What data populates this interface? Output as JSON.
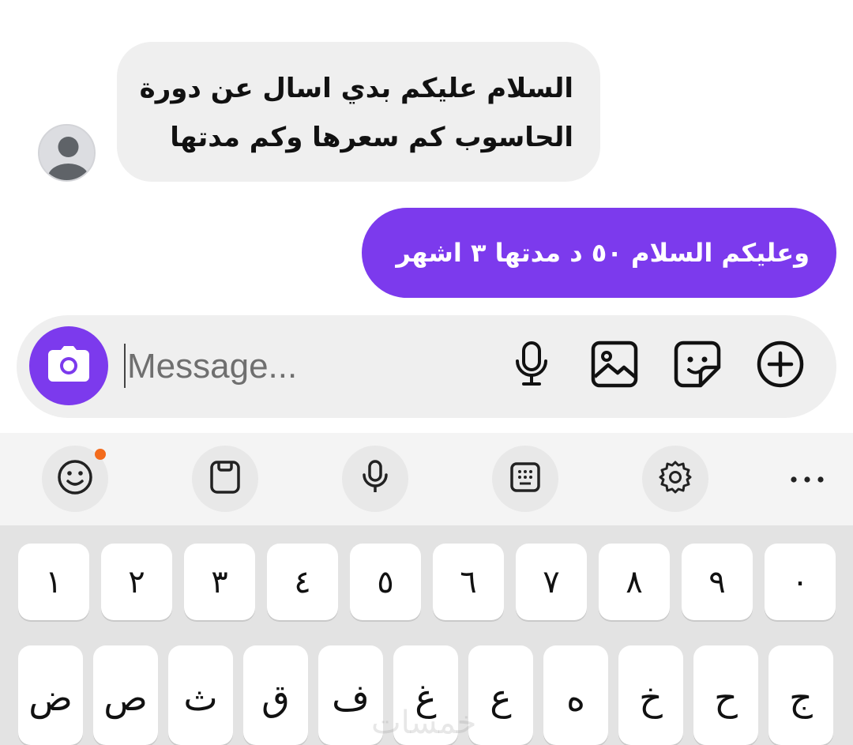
{
  "conversation": {
    "incoming": {
      "lines": [
        "السلام عليكم بدي اسال عن دورة",
        "الحاسوب كم سعرها وكم مدتها"
      ],
      "avatar_icon": "user-avatar-icon"
    },
    "outgoing": {
      "text": "وعليكم السلام ٥٠ د مدتها ٣ اشهر"
    },
    "colors": {
      "accent": "#7c3aed",
      "incoming_bubble": "#efefef"
    }
  },
  "composer": {
    "placeholder": "Message...",
    "value": "",
    "camera_icon": "camera-icon",
    "mic_icon": "microphone-icon",
    "gallery_icon": "image-icon",
    "sticker_icon": "sticker-icon",
    "add_icon": "plus-circle-icon"
  },
  "keyboard": {
    "toolbar": {
      "emoji_icon": "emoji-icon",
      "clipboard_icon": "clipboard-icon",
      "voice_icon": "microphone-icon",
      "keypad_icon": "keypad-icon",
      "settings_icon": "gear-icon",
      "more_icon": "more-horizontal-icon",
      "badge_color": "#f36b1c"
    },
    "number_row": [
      "١",
      "٢",
      "٣",
      "٤",
      "٥",
      "٦",
      "٧",
      "٨",
      "٩",
      "٠"
    ],
    "letter_row": [
      "ض",
      "ص",
      "ث",
      "ق",
      "ف",
      "غ",
      "ع",
      "ه",
      "خ",
      "ح",
      "ج"
    ]
  },
  "watermark": {
    "text": "خمسات"
  }
}
